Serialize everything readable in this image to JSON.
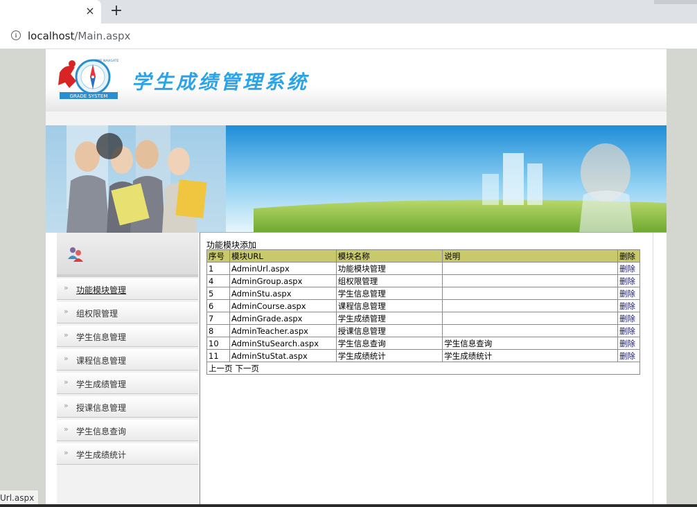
{
  "browser": {
    "url_host": "localhost",
    "url_path": "/Main.aspx",
    "tab_close": "×",
    "new_tab": "+"
  },
  "header": {
    "title": "学生成绩管理系统",
    "logo_text": "GRADE SYSTEM",
    "logo_arc_text": "TIME NAVIGATE"
  },
  "sidebar": {
    "items": [
      {
        "label": "功能模块管理",
        "active": true
      },
      {
        "label": "组权限管理"
      },
      {
        "label": "学生信息管理"
      },
      {
        "label": "课程信息管理"
      },
      {
        "label": "学生成绩管理"
      },
      {
        "label": "授课信息管理"
      },
      {
        "label": "学生信息查询"
      },
      {
        "label": "学生成绩统计"
      }
    ]
  },
  "main": {
    "add_link": "功能模块添加",
    "columns": [
      "序号",
      "模块URL",
      "模块名称",
      "说明",
      "删除"
    ],
    "rows": [
      [
        "1",
        "AdminUrl.aspx",
        "功能模块管理",
        "",
        "删除"
      ],
      [
        "4",
        "AdminGroup.aspx",
        "组权限管理",
        "",
        "删除"
      ],
      [
        "5",
        "AdminStu.aspx",
        "学生信息管理",
        "",
        "删除"
      ],
      [
        "6",
        "AdminCourse.aspx",
        "课程信息管理",
        "",
        "删除"
      ],
      [
        "7",
        "AdminGrade.aspx",
        "学生成绩管理",
        "",
        "删除"
      ],
      [
        "8",
        "AdminTeacher.aspx",
        "授课信息管理",
        "",
        "删除"
      ],
      [
        "10",
        "AdminStuSearch.aspx",
        "学生信息查询",
        "学生信息查询",
        "删除"
      ],
      [
        "11",
        "AdminStuStat.aspx",
        "学生成绩统计",
        "学生成绩统计",
        "删除"
      ]
    ],
    "pager": {
      "prev": "上一页",
      "next": "下一页"
    }
  },
  "status_tip": "Url.aspx",
  "colors": {
    "title": "#2aa3e8",
    "table_header": "#c8c96a",
    "page_bg": "#d4d6d0"
  }
}
